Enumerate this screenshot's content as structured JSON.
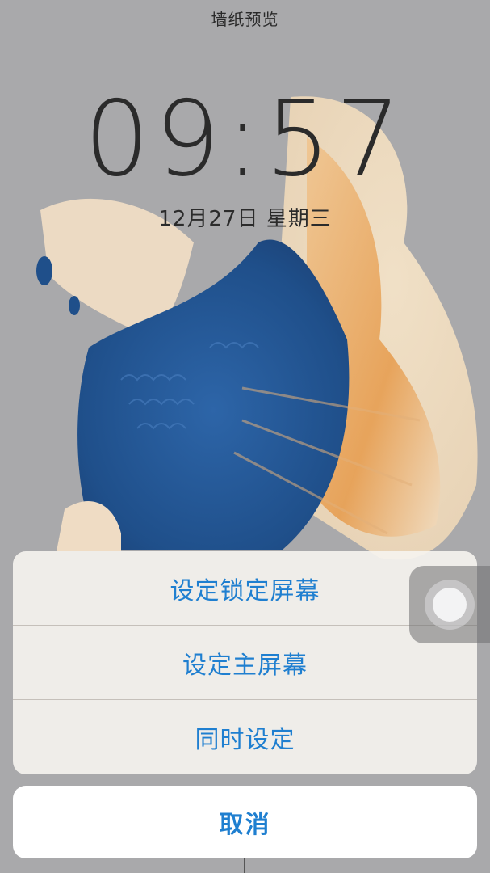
{
  "preview": {
    "title": "墙纸预览"
  },
  "lockscreen": {
    "time": "09:57",
    "date": "12月27日 星期三"
  },
  "action_sheet": {
    "options": [
      {
        "label": "设定锁定屏幕"
      },
      {
        "label": "设定主屏幕"
      },
      {
        "label": "同时设定"
      }
    ],
    "cancel_label": "取消"
  },
  "colors": {
    "accent": "#1f7fd0",
    "background": "#a9a9ab",
    "fish_blue": "#1f4f8a",
    "fin_cream": "#f1dcc0",
    "fin_orange": "#e7a35a"
  },
  "icons": {
    "assistive_touch": "assistive-touch-icon"
  }
}
